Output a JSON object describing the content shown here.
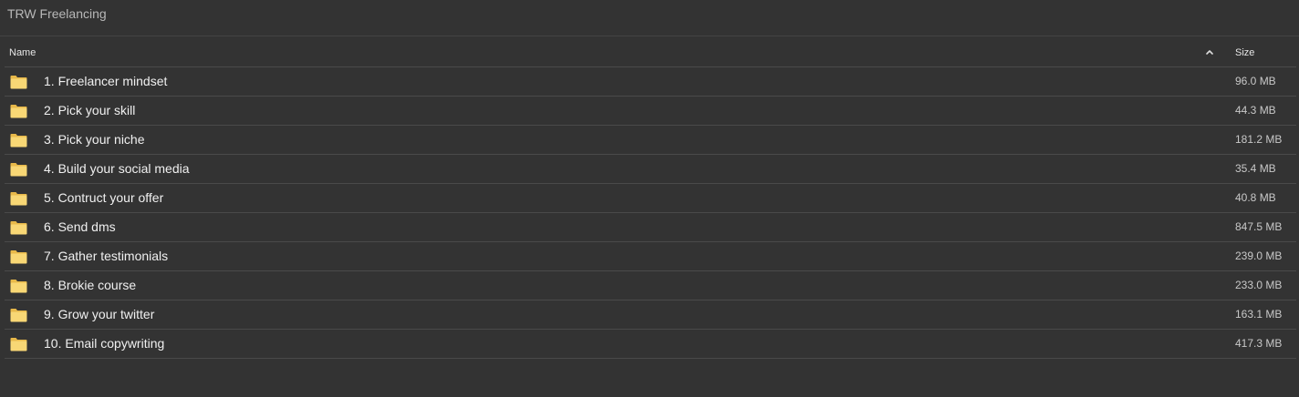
{
  "window": {
    "title": "TRW Freelancing"
  },
  "table": {
    "columns": {
      "name": "Name",
      "size": "Size"
    },
    "sort": {
      "column": "name",
      "direction": "ascending",
      "icon": "chevron-up-icon"
    },
    "rows": [
      {
        "name": "1. Freelancer mindset",
        "size": "96.0 MB",
        "type": "folder"
      },
      {
        "name": "2. Pick your skill",
        "size": "44.3 MB",
        "type": "folder"
      },
      {
        "name": "3. Pick your niche",
        "size": "181.2 MB",
        "type": "folder"
      },
      {
        "name": "4. Build your social media",
        "size": "35.4 MB",
        "type": "folder"
      },
      {
        "name": "5. Contruct your offer",
        "size": "40.8 MB",
        "type": "folder"
      },
      {
        "name": "6. Send dms",
        "size": "847.5 MB",
        "type": "folder"
      },
      {
        "name": "7. Gather testimonials",
        "size": "239.0 MB",
        "type": "folder"
      },
      {
        "name": "8. Brokie course",
        "size": "233.0 MB",
        "type": "folder"
      },
      {
        "name": "9. Grow your twitter",
        "size": "163.1 MB",
        "type": "folder"
      },
      {
        "name": "10. Email copywriting",
        "size": "417.3 MB",
        "type": "folder"
      }
    ]
  },
  "colors": {
    "background": "#333333",
    "folder": "#f8d775",
    "folder_dark": "#e8b94a",
    "divider": "#4a4a4a"
  }
}
